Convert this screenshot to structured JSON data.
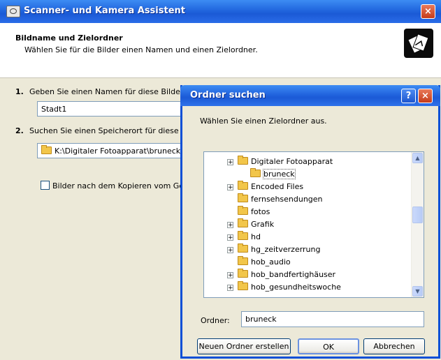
{
  "window": {
    "title": "Scanner- und Kamera Assistent",
    "close_label": "×"
  },
  "header": {
    "title": "Bildname und Zielordner",
    "subtitle": "Wählen Sie für die Bilder einen Namen und einen Zielordner."
  },
  "step1": {
    "number": "1.",
    "label": "Geben Sie einen Namen für diese Bilder",
    "value": "Stadt1"
  },
  "step2": {
    "number": "2.",
    "label": "Suchen Sie einen Speicherort für diese I",
    "path": "K:\\Digitaler Fotoapparat\\bruneck"
  },
  "checkbox_label": "Bilder nach dem Kopieren vom Gerät",
  "dialog": {
    "title": "Ordner suchen",
    "help_label": "?",
    "close_label": "×",
    "instruction": "Wählen Sie einen Zielordner aus.",
    "tree": [
      {
        "label": "Digitaler Fotoapparat",
        "expandable": true,
        "level": 0
      },
      {
        "label": "bruneck",
        "expandable": false,
        "level": 1,
        "selected": true
      },
      {
        "label": "Encoded Files",
        "expandable": true,
        "level": 0
      },
      {
        "label": "fernsehsendungen",
        "expandable": false,
        "level": 0
      },
      {
        "label": "fotos",
        "expandable": false,
        "level": 0
      },
      {
        "label": "Grafik",
        "expandable": true,
        "level": 0
      },
      {
        "label": "hd",
        "expandable": true,
        "level": 0
      },
      {
        "label": "hg_zeitverzerrung",
        "expandable": true,
        "level": 0
      },
      {
        "label": "hob_audio",
        "expandable": false,
        "level": 0
      },
      {
        "label": "hob_bandfertighäuser",
        "expandable": true,
        "level": 0
      },
      {
        "label": "hob_gesundheitswoche",
        "expandable": true,
        "level": 0
      }
    ],
    "folder_label": "Ordner:",
    "folder_value": "bruneck",
    "buttons": {
      "new_folder": "Neuen Ordner erstellen",
      "ok": "OK",
      "cancel": "Abbrechen"
    },
    "scroll": {
      "up": "▲",
      "down": "▼"
    }
  },
  "colors": {
    "titlebar": "#2166de",
    "close_button": "#c53b1a",
    "window_bg": "#ece9d8",
    "folder": "#f2c64a"
  }
}
